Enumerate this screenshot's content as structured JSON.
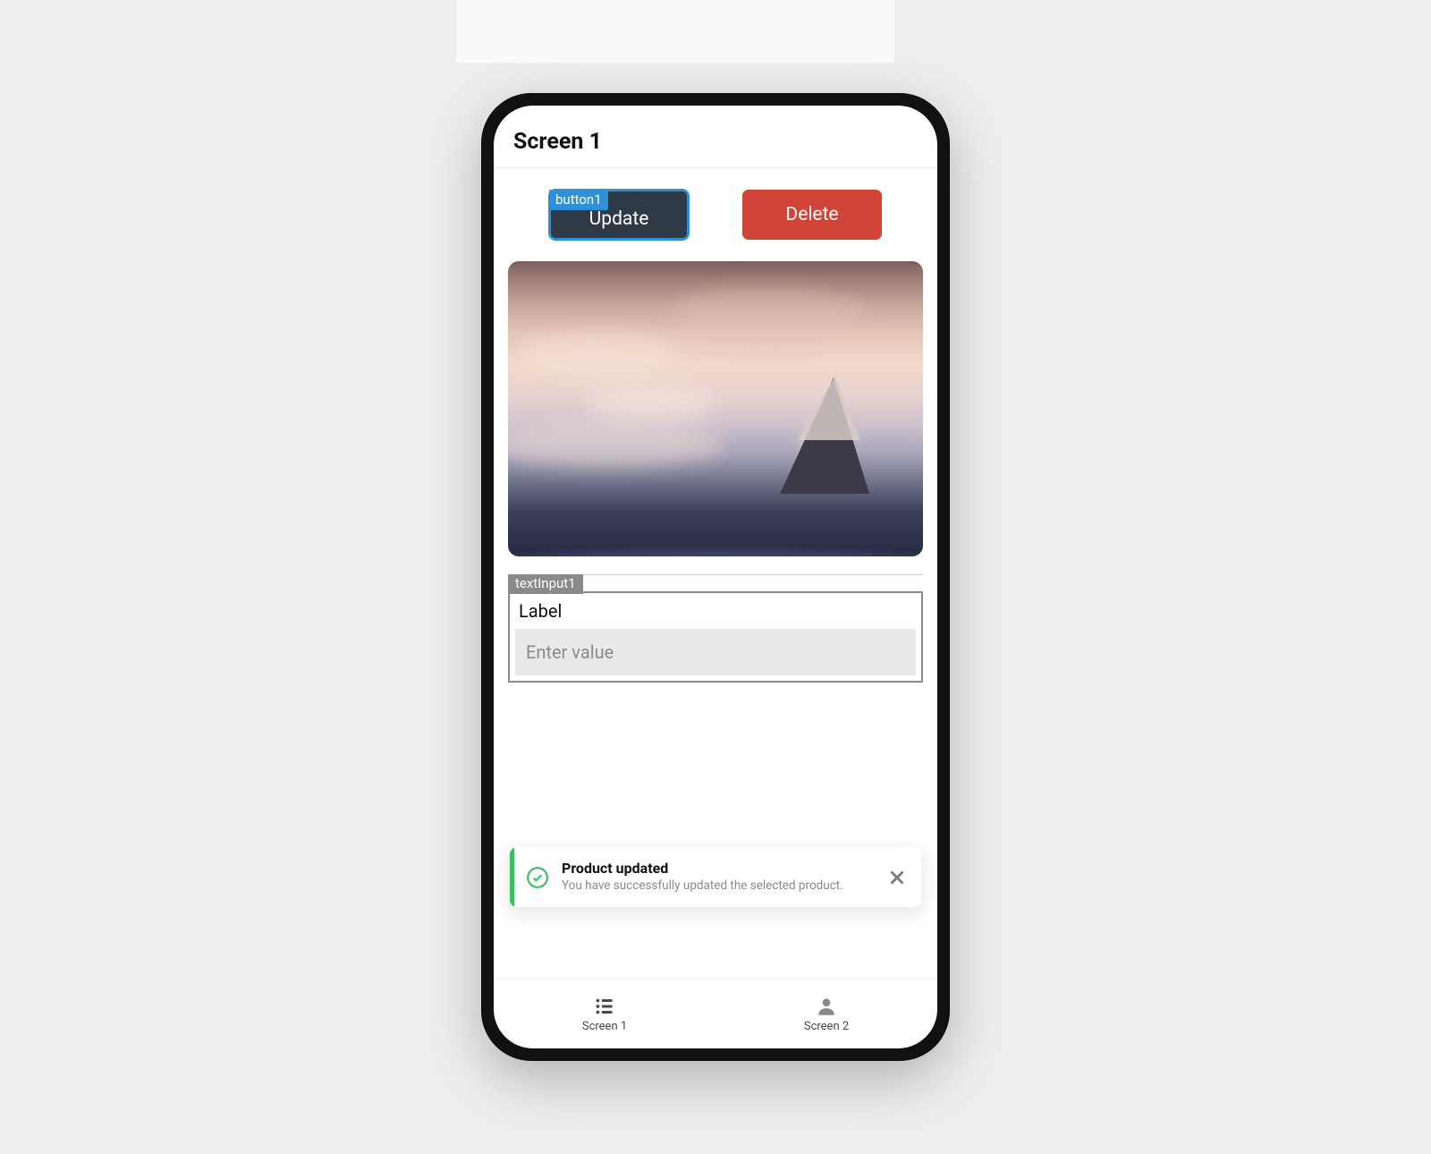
{
  "header": {
    "title": "Screen 1"
  },
  "buttons": {
    "update": {
      "tag": "button1",
      "label": "Update"
    },
    "delete": {
      "label": "Delete"
    }
  },
  "textInput": {
    "tag": "textInput1",
    "label": "Label",
    "placeholder": "Enter value"
  },
  "toast": {
    "title": "Product updated",
    "message": "You have successfully updated the selected product."
  },
  "nav": {
    "items": [
      {
        "label": "Screen 1"
      },
      {
        "label": "Screen 2"
      }
    ]
  }
}
